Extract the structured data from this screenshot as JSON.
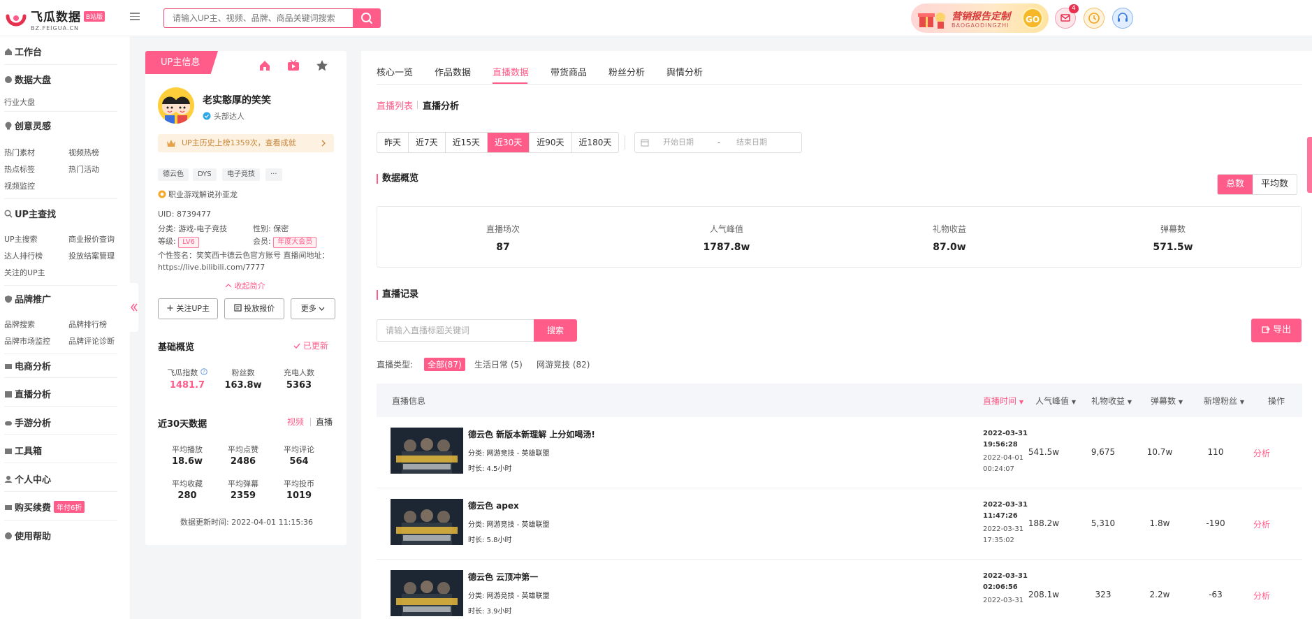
{
  "header": {
    "logo_name": "飞瓜数据",
    "logo_badge": "B站版",
    "logo_sub": "BZ.FEIGUA.CN",
    "search_placeholder": "请输入UP主、视频、品牌、商品关键词搜索",
    "banner_title": "营销报告定制",
    "banner_sub": "BAOGAODINGZHI",
    "banner_go": "GO",
    "message_count": "4"
  },
  "sidebar": {
    "workbench": "工作台",
    "data_board": "数据大盘",
    "industry_board": "行业大盘",
    "creative": "创意灵感",
    "creative_items": [
      "热门素材",
      "视频热榜",
      "热点标签",
      "热门活动",
      "视频监控"
    ],
    "up_search": "UP主查找",
    "up_items": [
      "UP主搜索",
      "商业报价查询",
      "达人排行榜",
      "投放结案管理",
      "关注的UP主"
    ],
    "brand": "品牌推广",
    "brand_items": [
      "品牌搜索",
      "品牌排行榜",
      "品牌市场监控",
      "品牌评论诊断"
    ],
    "ecommerce": "电商分析",
    "live": "直播分析",
    "mobile_game": "手游分析",
    "toolbox": "工具箱",
    "personal": "个人中心",
    "buy": "购买续费",
    "buy_badge": "年付6折",
    "help": "使用帮助"
  },
  "profile": {
    "tab_label": "UP主信息",
    "name": "老实憨厚的笑笑",
    "level_tag": "头部达人",
    "notice": "UP主历史上榜1359次，查看成就",
    "tags": [
      "德云色",
      "DYS",
      "电子竞技",
      "···"
    ],
    "pro_label": "职业游戏解说孙亚龙",
    "uid": "UID: 8739477",
    "category": "分类: 游戏-电子竞技",
    "gender": "性别: 保密",
    "level_label": "等级:",
    "level_value": "LV6",
    "member_label": "会员:",
    "member_value": "年度大会员",
    "signature": "个性签名：笑笑西卡德云色官方账号 直播间地址：https://live.bilibili.com/7777",
    "collapse_intro": "收起简介",
    "follow_btn": "关注UP主",
    "quote_btn": "投放报价",
    "more_btn": "更多",
    "basic_title": "基础概览",
    "updated": "已更新",
    "basic_stats": [
      {
        "label": "飞瓜指数",
        "value": "1481.7"
      },
      {
        "label": "粉丝数",
        "value": "163.8w"
      },
      {
        "label": "充电人数",
        "value": "5363"
      }
    ],
    "recent_title": "近30天数据",
    "video_link": "视频",
    "live_link": "直播",
    "recent_stats": [
      {
        "label": "平均播放",
        "value": "18.6w"
      },
      {
        "label": "平均点赞",
        "value": "2486"
      },
      {
        "label": "平均评论",
        "value": "564"
      },
      {
        "label": "平均收藏",
        "value": "280"
      },
      {
        "label": "平均弹幕",
        "value": "2359"
      },
      {
        "label": "平均投币",
        "value": "1019"
      }
    ],
    "update_time": "数据更新时间:    2022-04-01 11:15:36"
  },
  "main": {
    "tabs": [
      "核心一览",
      "作品数据",
      "直播数据",
      "带货商品",
      "粉丝分析",
      "舆情分析"
    ],
    "subtab_list": "直播列表",
    "subtab_analysis": "直播分析",
    "periods": [
      "昨天",
      "近7天",
      "近15天",
      "近30天",
      "近90天",
      "近180天"
    ],
    "date_start": "开始日期",
    "date_sep": "-",
    "date_end": "结束日期",
    "overview_title": "数据概览",
    "seg_total": "总数",
    "seg_avg": "平均数",
    "overview": [
      {
        "label": "直播场次",
        "value": "87"
      },
      {
        "label": "人气峰值",
        "value": "1787.8w"
      },
      {
        "label": "礼物收益",
        "value": "87.0w"
      },
      {
        "label": "弹幕数",
        "value": "571.5w"
      }
    ],
    "records_title": "直播记录",
    "live_search_placeholder": "请输入直播标题关键词",
    "live_search_btn": "搜索",
    "export_btn": "导出",
    "type_label": "直播类型:",
    "types": [
      "全部(87)",
      "生活日常 (5)",
      "网游竞技 (82)"
    ],
    "table_headers": [
      "直播信息",
      "直播时间",
      "人气峰值",
      "礼物收益",
      "弹幕数",
      "新增粉丝",
      "操作"
    ],
    "rows": [
      {
        "title": "德云色 新版本新理解 上分如喝汤!",
        "category": "分类:  网游竞技 - 英雄联盟",
        "duration": "时长:  4.5小时",
        "start": "2022-03-31 19:56:28",
        "end": "2022-04-01 00:24:07",
        "peak": "541.5w",
        "gift": "9,675",
        "danmaku": "10.7w",
        "fans": "110",
        "action": "分析"
      },
      {
        "title": "德云色 apex",
        "category": "分类:  网游竞技 - 英雄联盟",
        "duration": "时长:  5.8小时",
        "start": "2022-03-31 11:47:26",
        "end": "2022-03-31 17:35:02",
        "peak": "188.2w",
        "gift": "5,310",
        "danmaku": "1.8w",
        "fans": "-190",
        "action": "分析"
      },
      {
        "title": "德云色 云顶冲第一",
        "category": "分类:  网游竞技 - 英雄联盟",
        "duration": "时长:  3.9小时",
        "start": "2022-03-31 02:06:56",
        "end": "2022-03-31",
        "peak": "208.1w",
        "gift": "323",
        "danmaku": "2.2w",
        "fans": "-63",
        "action": "分析"
      }
    ]
  },
  "colors": {
    "accent": "#ff5c8a"
  }
}
